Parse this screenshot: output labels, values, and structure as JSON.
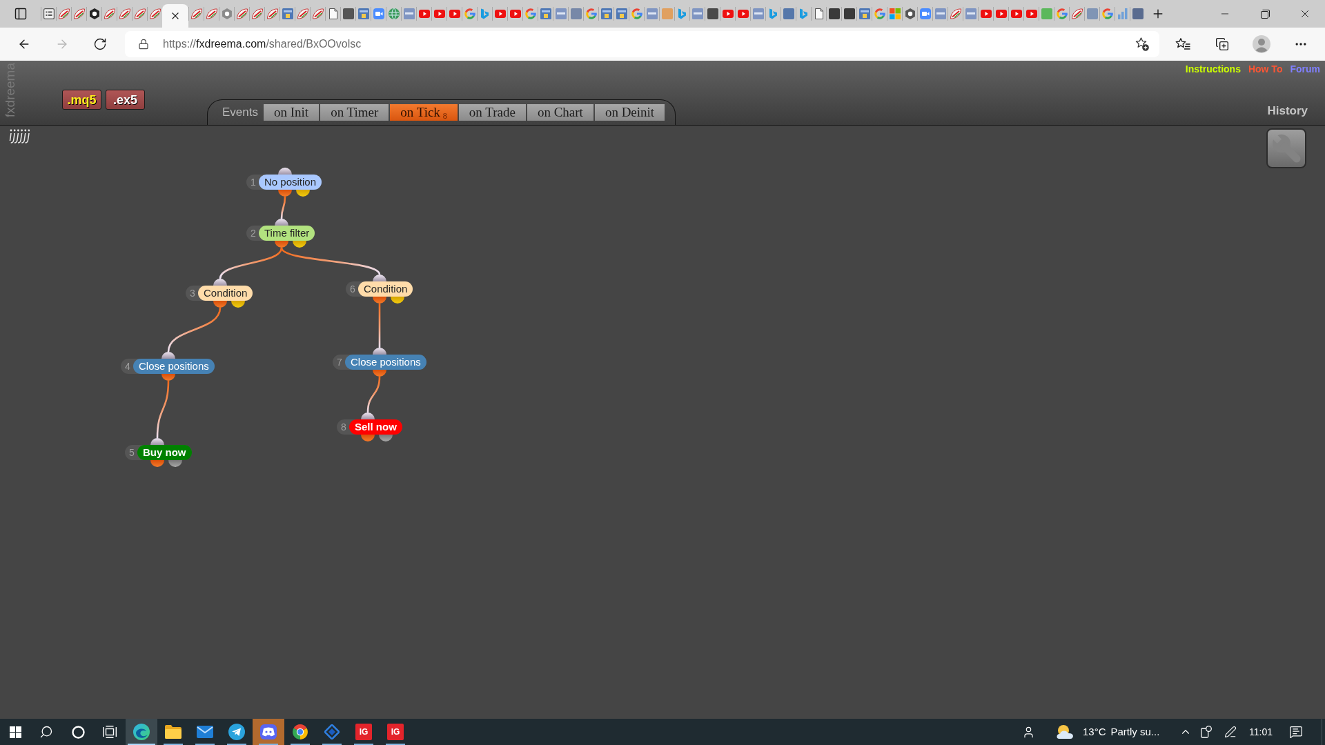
{
  "browser": {
    "tabs": [
      {
        "kind": "grid-doc",
        "selected": false
      },
      {
        "kind": "leaf",
        "selected": false
      },
      {
        "kind": "leaf",
        "selected": false
      },
      {
        "kind": "hexagon",
        "color": "#222222",
        "selected": false
      },
      {
        "kind": "leaf",
        "selected": false
      },
      {
        "kind": "leaf",
        "selected": false
      },
      {
        "kind": "leaf",
        "selected": false
      },
      {
        "kind": "leaf",
        "selected": false
      },
      {
        "selected": true
      },
      {
        "kind": "leaf",
        "selected": false
      },
      {
        "kind": "leaf",
        "selected": false
      },
      {
        "kind": "hexagon",
        "color": "#8a8a8a",
        "selected": false
      },
      {
        "kind": "leaf",
        "selected": false
      },
      {
        "kind": "leaf",
        "selected": false
      },
      {
        "kind": "leaf",
        "selected": false
      },
      {
        "kind": "mql5",
        "selected": false
      },
      {
        "kind": "leaf",
        "selected": false
      },
      {
        "kind": "leaf",
        "selected": false
      },
      {
        "kind": "doc",
        "selected": false
      },
      {
        "kind": "tile",
        "color": "#555555",
        "selected": false
      },
      {
        "kind": "mql5",
        "selected": false
      },
      {
        "kind": "video",
        "selected": false
      },
      {
        "kind": "globe",
        "selected": false
      },
      {
        "kind": "mql4",
        "selected": false
      },
      {
        "kind": "youtube",
        "selected": false
      },
      {
        "kind": "youtube",
        "selected": false
      },
      {
        "kind": "youtube",
        "selected": false
      },
      {
        "kind": "google",
        "selected": false
      },
      {
        "kind": "bing",
        "selected": false
      },
      {
        "kind": "youtube",
        "selected": false
      },
      {
        "kind": "youtube",
        "selected": false
      },
      {
        "kind": "google",
        "selected": false
      },
      {
        "kind": "mql5",
        "selected": false
      },
      {
        "kind": "mql4",
        "selected": false
      },
      {
        "kind": "tile",
        "color": "#7788a8",
        "selected": false
      },
      {
        "kind": "google",
        "selected": false
      },
      {
        "kind": "mql5",
        "selected": false
      },
      {
        "kind": "mql5",
        "selected": false
      },
      {
        "kind": "google",
        "selected": false
      },
      {
        "kind": "mql4",
        "selected": false
      },
      {
        "kind": "tile",
        "color": "#e0a060",
        "selected": false
      },
      {
        "kind": "bing",
        "selected": false
      },
      {
        "kind": "mql4",
        "selected": false
      },
      {
        "kind": "tile",
        "color": "#4a4a4a",
        "selected": false
      },
      {
        "kind": "youtube",
        "selected": false
      },
      {
        "kind": "youtube",
        "selected": false
      },
      {
        "kind": "mql4",
        "selected": false
      },
      {
        "kind": "bing",
        "selected": false
      },
      {
        "kind": "tile",
        "color": "#5577aa",
        "selected": false
      },
      {
        "kind": "bing",
        "selected": false
      },
      {
        "kind": "doc",
        "selected": false
      },
      {
        "kind": "tile",
        "color": "#3a3a3a",
        "selected": false
      },
      {
        "kind": "tile",
        "color": "#3a3a3a",
        "selected": false
      },
      {
        "kind": "mql5",
        "selected": false
      },
      {
        "kind": "google",
        "selected": false
      },
      {
        "kind": "microsoft",
        "selected": false
      },
      {
        "kind": "hexagon",
        "color": "#555555",
        "selected": false
      },
      {
        "kind": "video",
        "selected": false
      },
      {
        "kind": "mql4",
        "selected": false
      },
      {
        "kind": "leaf",
        "selected": false
      },
      {
        "kind": "mql4",
        "selected": false
      },
      {
        "kind": "youtube",
        "selected": false
      },
      {
        "kind": "youtube",
        "selected": false
      },
      {
        "kind": "youtube",
        "selected": false
      },
      {
        "kind": "youtube",
        "selected": false
      },
      {
        "kind": "tile",
        "color": "#5cb85c",
        "selected": false
      },
      {
        "kind": "google",
        "selected": false
      },
      {
        "kind": "leaf",
        "selected": false
      },
      {
        "kind": "tile",
        "color": "#8095b5",
        "selected": false
      },
      {
        "kind": "google",
        "selected": false
      },
      {
        "kind": "chart",
        "selected": false
      },
      {
        "kind": "tile",
        "color": "#596b8f",
        "selected": false
      }
    ],
    "nav": [
      {
        "kind": "back",
        "disabled": false
      },
      {
        "kind": "forward",
        "disabled": true
      },
      {
        "kind": "refresh",
        "disabled": false
      }
    ],
    "address": {
      "scheme": "https://",
      "host": "fxdreema.com",
      "path": "/shared/BxOOvolsc"
    }
  },
  "app": {
    "brand": "fxdreema",
    "export_buttons": [
      {
        "kind": "source",
        "label": ".mq5"
      },
      {
        "kind": "compiled",
        "label": ".ex5"
      }
    ],
    "links": [
      {
        "label": "Instructions",
        "color": "#ccff00"
      },
      {
        "label": "How To",
        "color": "#ff5533"
      },
      {
        "label": "Forum",
        "color": "#8080ff"
      }
    ],
    "events_label": "Events",
    "event_tabs": [
      {
        "label": "on Init",
        "selected": false
      },
      {
        "label": "on Timer",
        "selected": false
      },
      {
        "label": "on Tick",
        "count": "8",
        "selected": true
      },
      {
        "label": "on Trade",
        "selected": false
      },
      {
        "label": "on Chart",
        "selected": false
      },
      {
        "label": "on Deinit",
        "selected": false
      }
    ],
    "history": "History"
  },
  "diagram": {
    "blocks": [
      {
        "number": "1",
        "label": "No position",
        "kind": "condition",
        "color": "#a9c8ff",
        "children": [
          {
            "number": "2",
            "label": "Time filter",
            "kind": "condition",
            "color": "#b2e27f",
            "children": [
              {
                "number": "3",
                "label": "Condition",
                "kind": "condition",
                "color": "#ffdcaa",
                "children": [
                  {
                    "number": "4",
                    "label": "Close positions",
                    "kind": "action",
                    "color": "#4682b4",
                    "children": [
                      {
                        "number": "5",
                        "label": "Buy now",
                        "kind": "trade",
                        "color": "#008000"
                      }
                    ]
                  }
                ]
              },
              {
                "number": "6",
                "label": "Condition",
                "kind": "condition",
                "color": "#ffdcaa",
                "children": [
                  {
                    "number": "7",
                    "label": "Close positions",
                    "kind": "action",
                    "color": "#4682b4",
                    "children": [
                      {
                        "number": "8",
                        "label": "Sell now",
                        "kind": "trade",
                        "color": "#ff0000"
                      }
                    ]
                  }
                ]
              }
            ]
          }
        ]
      }
    ]
  },
  "taskbar": {
    "apps": [
      {
        "kind": "browser",
        "selected": true,
        "attention": false
      },
      {
        "kind": "folder",
        "selected": false,
        "attention": false
      },
      {
        "kind": "mail",
        "selected": false,
        "attention": false
      },
      {
        "kind": "messenger",
        "selected": false,
        "attention": false
      },
      {
        "kind": "chat",
        "selected": false,
        "attention": true
      },
      {
        "kind": "web",
        "selected": false,
        "attention": false
      },
      {
        "kind": "diamond",
        "selected": false,
        "attention": false
      },
      {
        "kind": "letters",
        "label": "IG",
        "selected": false,
        "attention": false
      },
      {
        "kind": "letters",
        "label": "IG",
        "selected": false,
        "attention": false
      }
    ],
    "weather": {
      "temperature": "13°C",
      "summary": "Partly su..."
    },
    "clock": "11:01"
  }
}
